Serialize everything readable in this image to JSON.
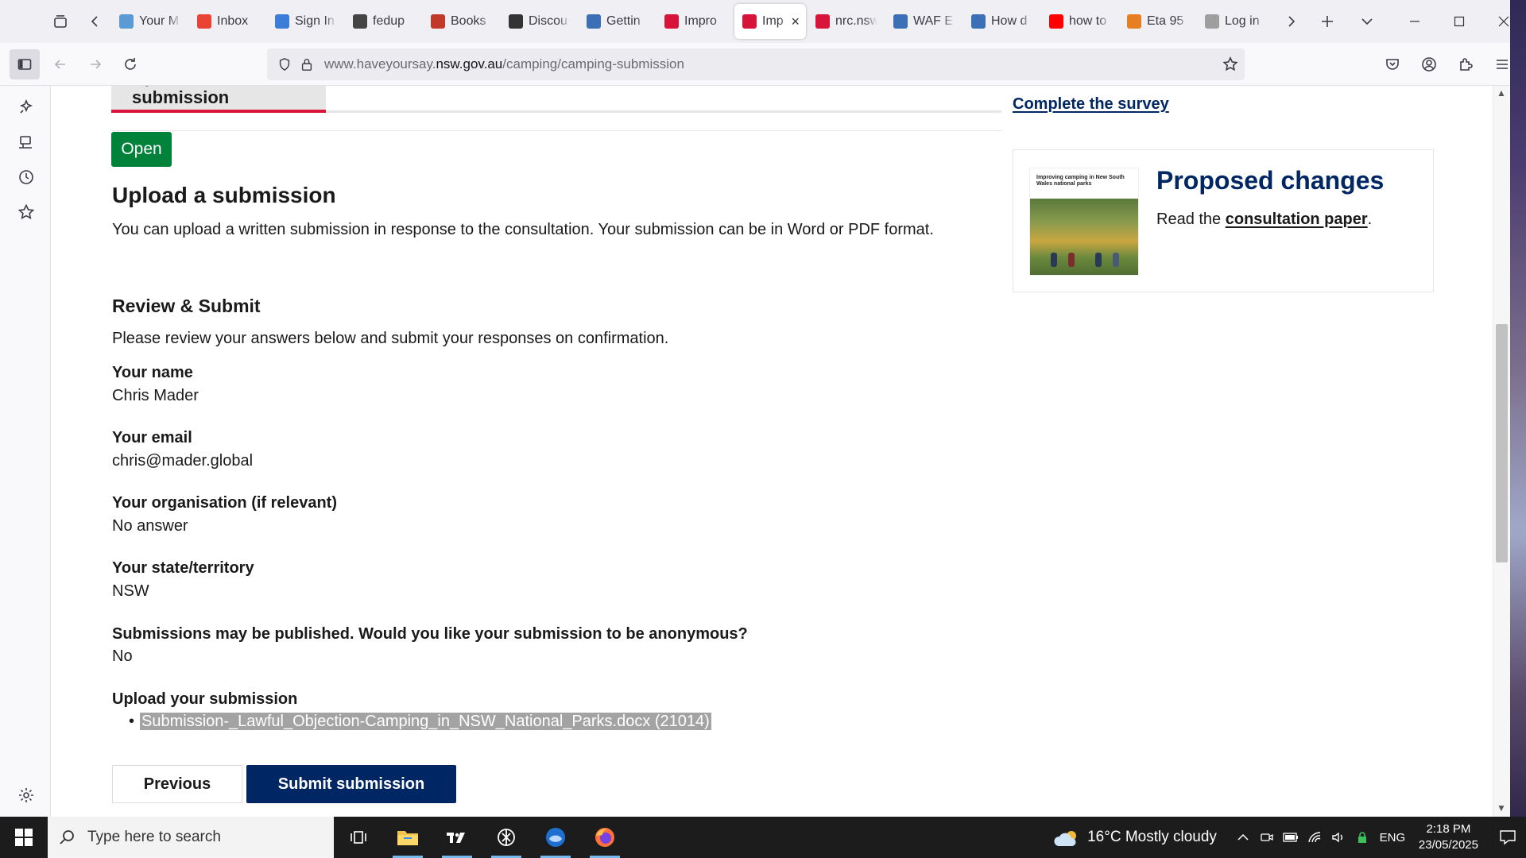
{
  "browser": {
    "tabs": [
      {
        "title": "Your M",
        "icon": "page-icon",
        "color": "#5b9bd5"
      },
      {
        "title": "Inbox",
        "icon": "gmail-icon",
        "color": "#ea4335"
      },
      {
        "title": "Sign In",
        "icon": "key-icon",
        "color": "#3b7dd8"
      },
      {
        "title": "fedup",
        "icon": "pocket-icon",
        "color": "#444444"
      },
      {
        "title": "Books",
        "icon": "books-icon",
        "color": "#c0392b"
      },
      {
        "title": "Discou",
        "icon": "columns-icon",
        "color": "#333333"
      },
      {
        "title": "Gettin",
        "icon": "nsw-icon",
        "color": "#3b6fb6"
      },
      {
        "title": "Impro",
        "icon": "waratah-icon",
        "color": "#d7153a"
      },
      {
        "title": "Imp",
        "icon": "waratah-icon",
        "color": "#d7153a",
        "active": true
      },
      {
        "title": "nrc.nsw",
        "icon": "nsw-gov-icon",
        "color": "#d7153a"
      },
      {
        "title": "WAF E",
        "icon": "nsw-icon",
        "color": "#3b6fb6"
      },
      {
        "title": "How d",
        "icon": "nsw-icon",
        "color": "#3b6fb6"
      },
      {
        "title": "how to",
        "icon": "youtube-icon",
        "color": "#ff0000"
      },
      {
        "title": "Eta 95",
        "icon": "store-icon",
        "color": "#e67e22"
      },
      {
        "title": "Log in",
        "icon": "p-icon",
        "color": "#9e9e9e"
      }
    ],
    "url_prefix": "www.haveyoursay.",
    "url_domain": "nsw.gov.au",
    "url_path": "/camping/camping-submission"
  },
  "page": {
    "tab_label": "Upload a submission",
    "status": "Open",
    "upload_heading": "Upload a submission",
    "upload_desc": "You can upload a written submission in response to the consultation. Your submission can be in Word or PDF format.",
    "review_heading": "Review & Submit",
    "review_desc": "Please review your answers below and submit your responses on confirmation.",
    "fields": [
      {
        "label": "Your name",
        "value": "Chris Mader"
      },
      {
        "label": "Your email",
        "value": "chris@mader.global"
      },
      {
        "label": "Your organisation (if relevant)",
        "value": "No answer"
      },
      {
        "label": "Your state/territory",
        "value": "NSW"
      },
      {
        "label": "Submissions may be published. Would you like your submission to be anonymous?",
        "value": "No"
      }
    ],
    "upload_label": "Upload your submission",
    "file_name": "Submission-_Lawful_Objection-Camping_in_NSW_National_Parks.docx (21014)",
    "btn_previous": "Previous",
    "btn_submit": "Submit submission",
    "survey_link": "Complete the survey",
    "card": {
      "thumb_text": "Improving camping in New South Wales national parks",
      "title": "Proposed changes",
      "text_before": "Read the ",
      "link": "consultation paper",
      "text_after": "."
    }
  },
  "taskbar": {
    "search_placeholder": "Type here to search",
    "weather": "16°C  Mostly cloudy",
    "lang": "ENG",
    "time": "2:18 PM",
    "date": "23/05/2025"
  },
  "colors": {
    "nsw_navy": "#002664",
    "nsw_red": "#d7153a",
    "open_green": "#00823b"
  }
}
